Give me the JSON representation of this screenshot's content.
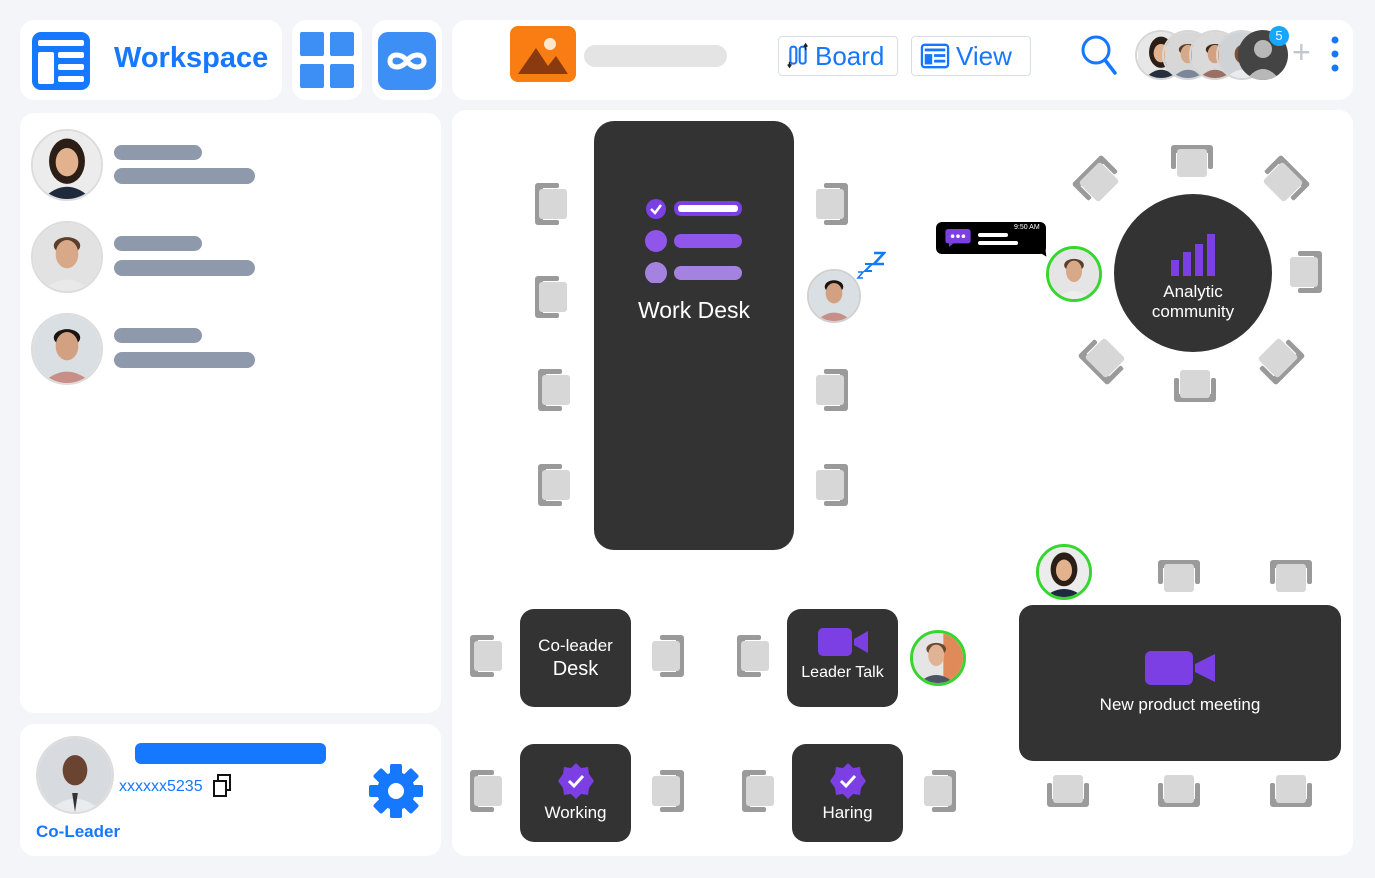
{
  "header": {
    "brand_label": "Workspace",
    "board_label": "Board",
    "view_label": "View",
    "participants_badge": "5",
    "add_symbol": "+"
  },
  "tables": {
    "work_desk": "Work Desk",
    "analytic_line1": "Analytic",
    "analytic_line2": "community",
    "coleader_line1": "Co-leader",
    "coleader_line2": "Desk",
    "leader_talk": "Leader Talk",
    "new_product": "New product meeting",
    "working": "Working",
    "haring": "Haring"
  },
  "chat_bubble": {
    "time": "9:50 AM"
  },
  "current_user": {
    "code": "xxxxxx5235",
    "role": "Co-Leader"
  },
  "colors": {
    "accent": "#1677ff",
    "purple": "#7b3fe4",
    "table": "#333333",
    "online_ring": "#35d62e",
    "sidebar_bar": "#8e99ab"
  }
}
